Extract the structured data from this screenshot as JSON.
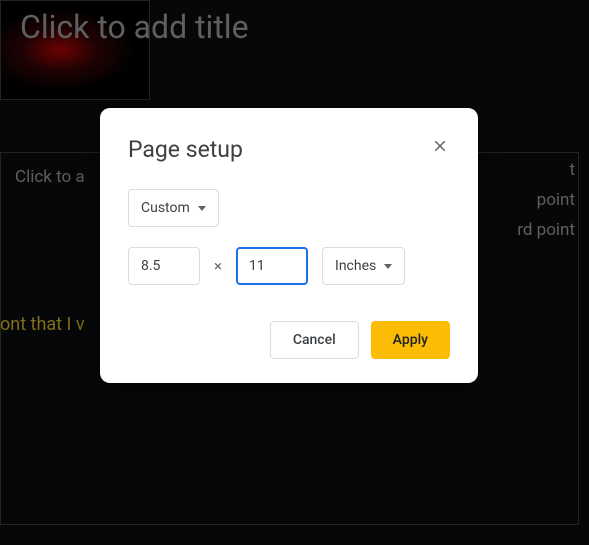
{
  "slide": {
    "title_placeholder": "Click to add title",
    "body_placeholder": "Click to a",
    "bullets": {
      "b1": "t",
      "b2": "point",
      "b3": "rd point"
    },
    "highlight_text": "ont that I v"
  },
  "dialog": {
    "title": "Page setup",
    "size_preset": "Custom",
    "width": "8.5",
    "height": "11",
    "unit": "Inches",
    "cancel_label": "Cancel",
    "apply_label": "Apply"
  }
}
